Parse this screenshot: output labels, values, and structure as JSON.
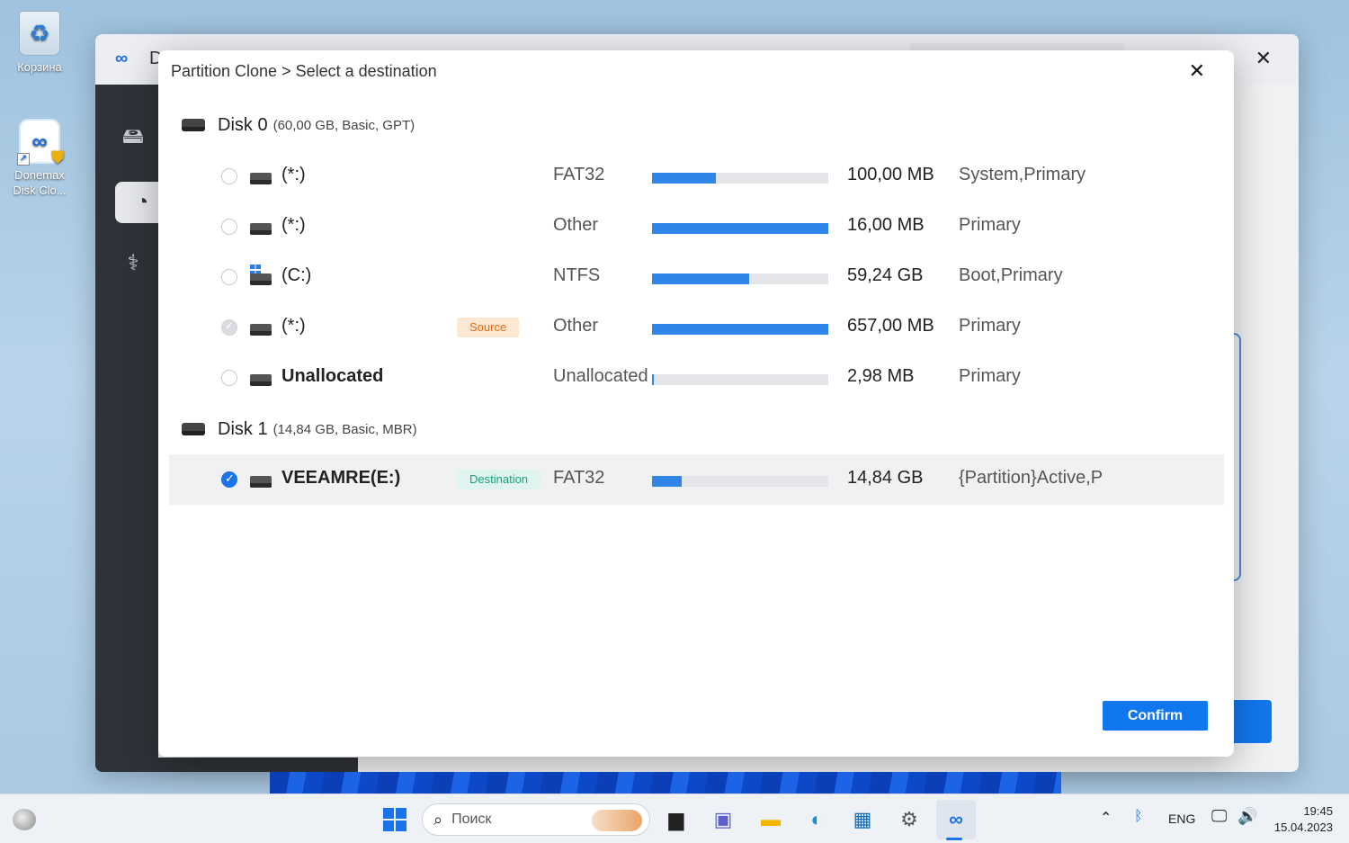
{
  "desktop": {
    "icons": [
      {
        "label": "Корзина"
      },
      {
        "label": "Donemax Disk Clo..."
      }
    ]
  },
  "app": {
    "title_fragment": "D",
    "close_glyph": "✕"
  },
  "modal": {
    "title": "Partition Clone > Select a destination",
    "close_glyph": "✕",
    "confirm_label": "Confirm",
    "disks": [
      {
        "name": "Disk 0",
        "info": "(60,00 GB, Basic, GPT)",
        "partitions": [
          {
            "name": "(*:)",
            "fs": "FAT32",
            "usage": 0.36,
            "size": "100,00 MB",
            "type": "System,Primary",
            "state": "unchecked",
            "tag": "",
            "icon": "drive-icon"
          },
          {
            "name": "(*:)",
            "fs": "Other",
            "usage": 1.0,
            "size": "16,00 MB",
            "type": "Primary",
            "state": "unchecked",
            "tag": "",
            "icon": "drive-icon"
          },
          {
            "name": "(C:)",
            "fs": "NTFS",
            "usage": 0.55,
            "size": "59,24 GB",
            "type": "Boot,Primary",
            "state": "unchecked",
            "tag": "",
            "icon": "windows-drive-icon"
          },
          {
            "name": "(*:)",
            "fs": "Other",
            "usage": 1.0,
            "size": "657,00 MB",
            "type": "Primary",
            "state": "disabled",
            "tag": "Source",
            "icon": "drive-icon"
          },
          {
            "name": "Unallocated",
            "fs": "Unallocated",
            "usage": 0.01,
            "size": "2,98 MB",
            "type": "Primary",
            "state": "unchecked",
            "tag": "",
            "icon": "drive-icon"
          }
        ]
      },
      {
        "name": "Disk 1",
        "info": "(14,84 GB, Basic, MBR)",
        "partitions": [
          {
            "name": "VEEAMRE(E:)",
            "fs": "FAT32",
            "usage": 0.17,
            "size": "14,84 GB",
            "type": "{Partition}Active,P",
            "state": "checked",
            "tag": "Destination",
            "icon": "drive-icon"
          }
        ]
      }
    ]
  },
  "taskbar": {
    "search_placeholder": "Поиск",
    "lang": "ENG",
    "time": "19:45",
    "date": "15.04.2023"
  },
  "colors": {
    "accent": "#1177ee",
    "bar_fill": "#2f86e6",
    "source_tag": "#e46a10",
    "dest_tag": "#19a27c"
  }
}
